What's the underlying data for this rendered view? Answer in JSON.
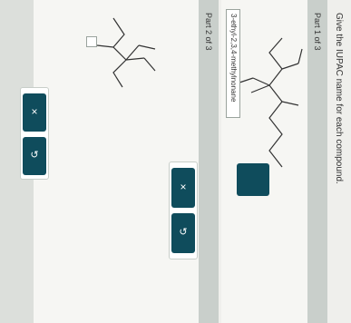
{
  "question": "Give the IUPAC name for each compound.",
  "parts": [
    {
      "label": "Part 1 of 3",
      "answer": "3-ethyl-2,3,4-methylnonane"
    },
    {
      "label": "Part 2 of 3",
      "answer": ""
    }
  ],
  "buttons": {
    "clear_icon": "×",
    "undo_icon": "↺"
  }
}
